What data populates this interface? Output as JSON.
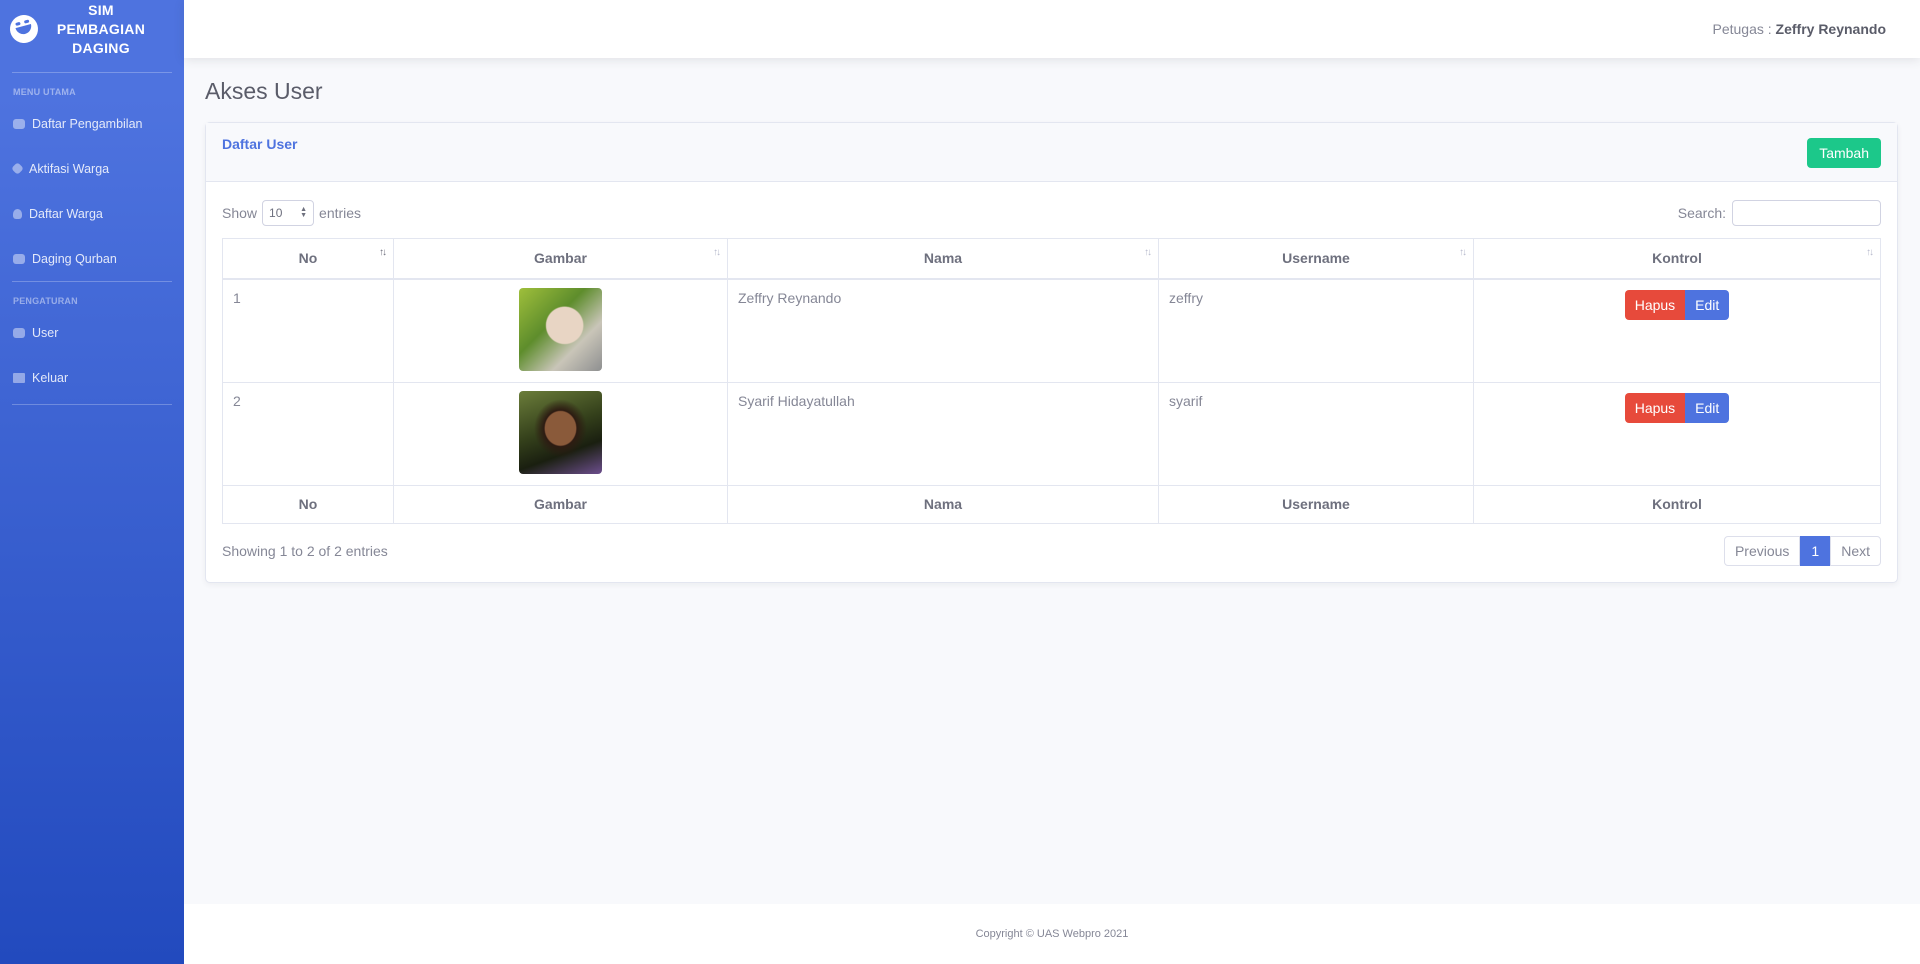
{
  "brand": {
    "name_lines": [
      "SIM",
      "PEMBAGIAN",
      "DAGING"
    ],
    "icon": "laugh-wink-icon"
  },
  "sidebar": {
    "heading_main": "MENU UTAMA",
    "heading_settings": "PENGATURAN",
    "items": [
      {
        "label": "Daftar Pengambilan",
        "icon": "hand-holding-icon"
      },
      {
        "label": "Aktifasi Warga",
        "icon": "tag-icon"
      },
      {
        "label": "Daftar Warga",
        "icon": "user-icon"
      },
      {
        "label": "Daging Qurban",
        "icon": "cow-icon"
      },
      {
        "label": "User",
        "icon": "users-icon"
      },
      {
        "label": "Keluar",
        "icon": "sign-out-icon"
      }
    ]
  },
  "topbar": {
    "label": "Petugas :",
    "user": "Zeffry Reynando"
  },
  "page": {
    "title": "Akses User"
  },
  "card": {
    "title": "Daftar User",
    "add_label": "Tambah"
  },
  "table_controls": {
    "show": "Show",
    "length": "10",
    "entries": "entries",
    "search": "Search:"
  },
  "table": {
    "columns": [
      "No",
      "Gambar",
      "Nama",
      "Username",
      "Kontrol"
    ],
    "rows": [
      {
        "no": "1",
        "nama": "Zeffry Reynando",
        "username": "zeffry",
        "delete": "Hapus",
        "edit": "Edit"
      },
      {
        "no": "2",
        "nama": "Syarif Hidayatullah",
        "username": "syarif",
        "delete": "Hapus",
        "edit": "Edit"
      }
    ]
  },
  "info": "Showing 1 to 2 of 2 entries",
  "pagination": {
    "previous": "Previous",
    "current": "1",
    "next": "Next"
  },
  "footer": {
    "text": "Copyright © UAS Webpro 2021"
  },
  "colors": {
    "primary": "#4e73df",
    "success": "#1cc88a",
    "danger": "#e74a3b"
  }
}
